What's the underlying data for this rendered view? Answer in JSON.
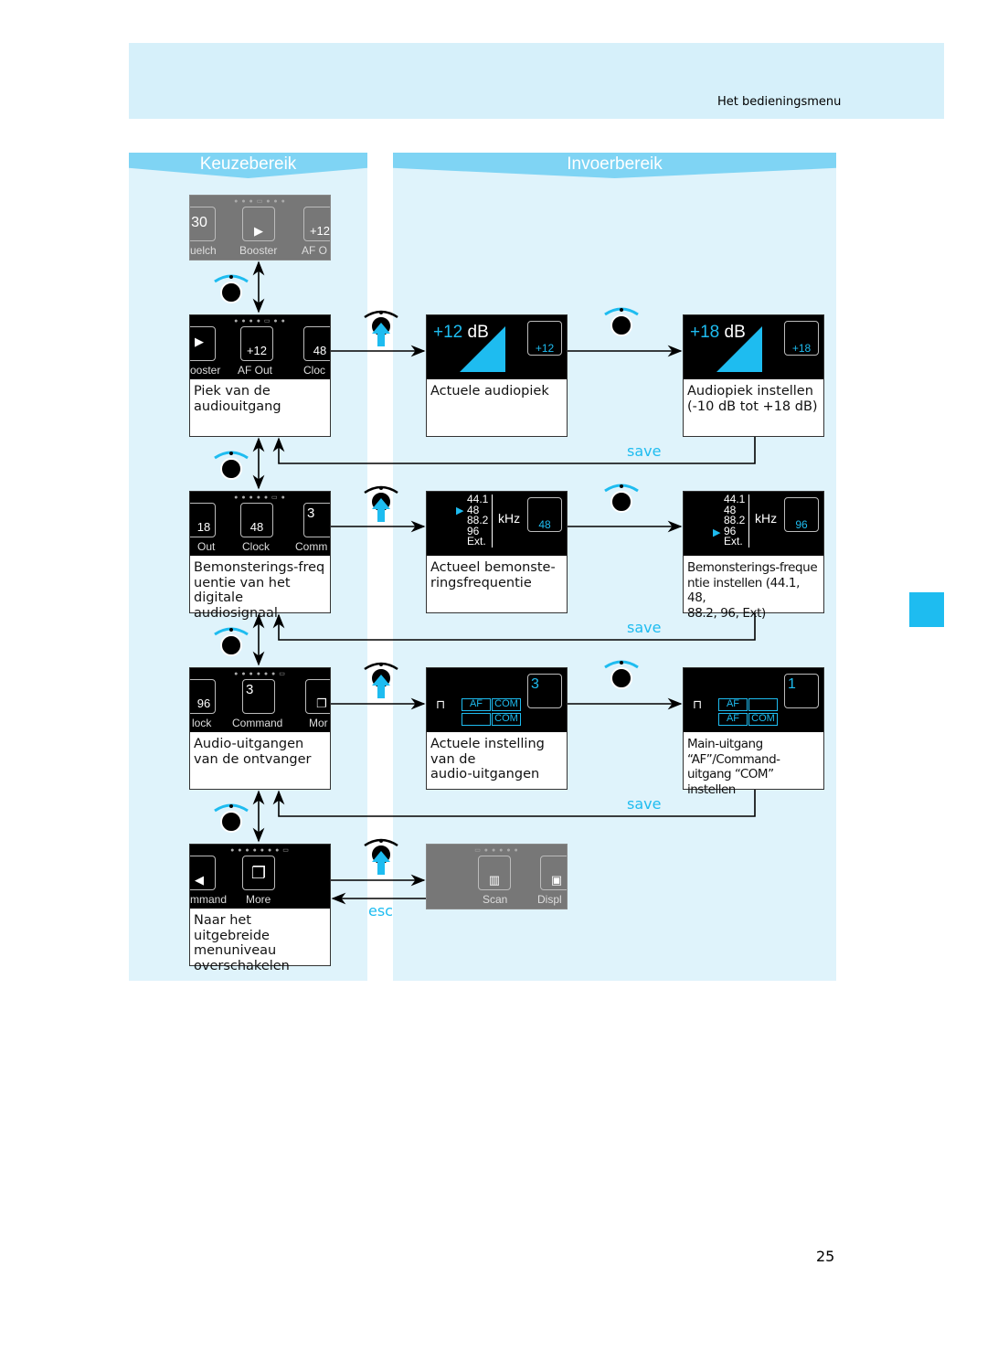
{
  "header": {
    "title": "Het bedieningsmenu"
  },
  "columns": {
    "left": "Keuzebereik",
    "right": "Invoerbereik"
  },
  "page_number": "25",
  "labels": {
    "save": "save",
    "esc": "esc"
  },
  "colors": {
    "accent": "#1ebcf0",
    "band": "#d6f0fa",
    "column": "#dff3fb"
  },
  "top_menu": {
    "labels": [
      "uelch",
      "Booster",
      "AF O"
    ],
    "values": [
      "30",
      "+12"
    ]
  },
  "rows": [
    {
      "menu": {
        "labels": [
          "ooster",
          "AF Out",
          "Cloc"
        ],
        "values": [
          "+12",
          "48"
        ]
      },
      "description": "Piek van de\naudiouitgang",
      "current": {
        "value": "+12",
        "unit": "dB",
        "badge": "+12",
        "description": "Actuele audiopiek"
      },
      "setting": {
        "value": "+18",
        "unit": "dB",
        "badge": "+18",
        "description": "Audiopiek instellen\n(-10 dB tot +18 dB)"
      }
    },
    {
      "menu": {
        "labels": [
          "Out",
          "Clock",
          "Comm"
        ],
        "values": [
          "18",
          "48",
          "3"
        ]
      },
      "description": "Bemonsterings-freq\nuentie van het\ndigitale audiosignaal",
      "options": [
        "44.1",
        "48",
        "88.2",
        "96",
        "Ext."
      ],
      "unit": "kHz",
      "current": {
        "selected": "48",
        "badge": "48",
        "description": "Actueel bemonste-\nringsfrequentie"
      },
      "setting": {
        "selected": "96",
        "badge": "96",
        "description": "Bemonsterings-freque\nntie instellen (44.1, 48,\n88.2, 96, Ext)"
      }
    },
    {
      "menu": {
        "labels": [
          "lock",
          "Command",
          "Mor"
        ],
        "values": [
          "96",
          "3"
        ]
      },
      "description": "Audio-uitgangen\nvan de ontvanger",
      "current": {
        "cells": [
          "AF",
          "COM",
          "",
          "COM"
        ],
        "badge": "3",
        "description": "Actuele instelling\nvan de\naudio-uitgangen"
      },
      "setting": {
        "cells": [
          "AF",
          "",
          "AF",
          "COM"
        ],
        "badge": "1",
        "description": "Main-uitgang\n“AF”/Command-\nuitgang “COM” instellen"
      }
    },
    {
      "menu": {
        "labels": [
          "mmand",
          "More"
        ]
      },
      "description": "Naar het uitgebreide\nmenuniveau\noverschakelen",
      "submenu": {
        "labels": [
          "Scan",
          "Displ"
        ]
      }
    }
  ]
}
